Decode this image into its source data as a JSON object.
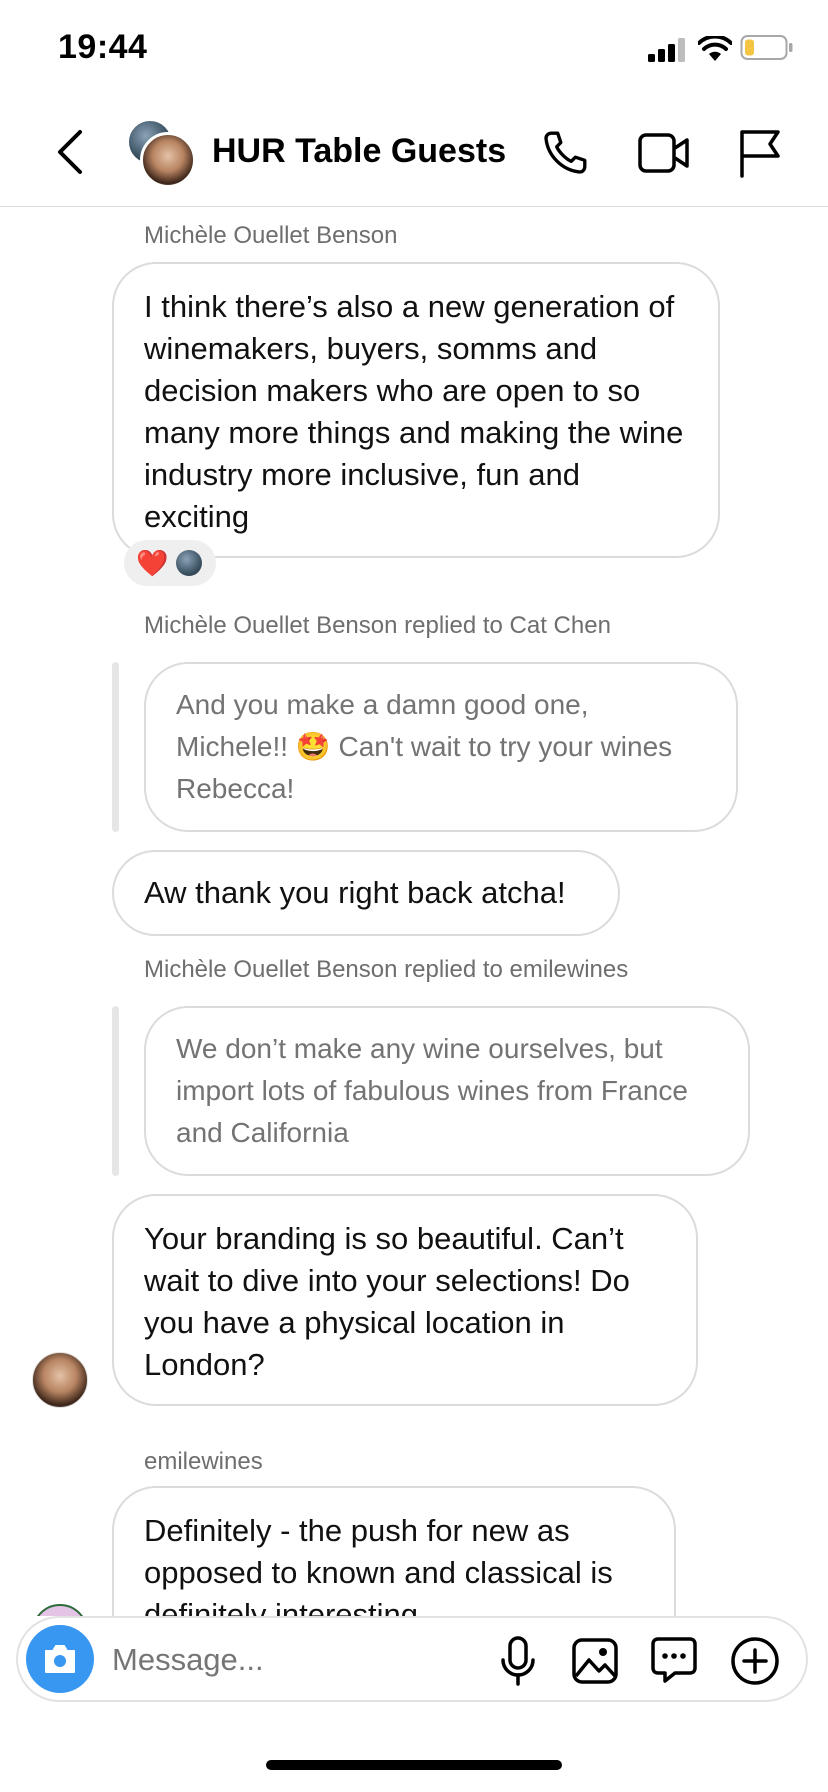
{
  "status_bar": {
    "time": "19:44"
  },
  "header": {
    "title": "HUR Table Guests"
  },
  "messages": [
    {
      "sender": "Michèle Ouellet Benson",
      "text": "I think there’s also a new generation of winemakers, buyers, somms and decision makers who are open to so many more things and making the wine industry more inclusive, fun and exciting",
      "reaction": "❤️"
    },
    {
      "sender": "Michèle Ouellet Benson replied to Cat Chen",
      "quoted_before": "And you make a damn good one, Michele!!",
      "quoted_emoji": "🤩",
      "quoted_after": "Can't wait to try your wines Rebecca!",
      "text": "Aw thank you right back atcha!"
    },
    {
      "sender": "Michèle Ouellet Benson replied to emilewines",
      "quoted": "We don’t make any wine ourselves, but import lots of fabulous wines from France and California",
      "text": "Your branding is so beautiful. Can’t wait to dive into your selections! Do you have a physical location in London?"
    },
    {
      "sender": "emilewines",
      "text": "Definitely - the push for new as opposed to known and classical is definitely interesting"
    }
  ],
  "composer": {
    "placeholder": "Message..."
  },
  "colors": {
    "camera_button": "#3897f0",
    "border": "#dbdbdb",
    "muted_text": "#737373"
  }
}
